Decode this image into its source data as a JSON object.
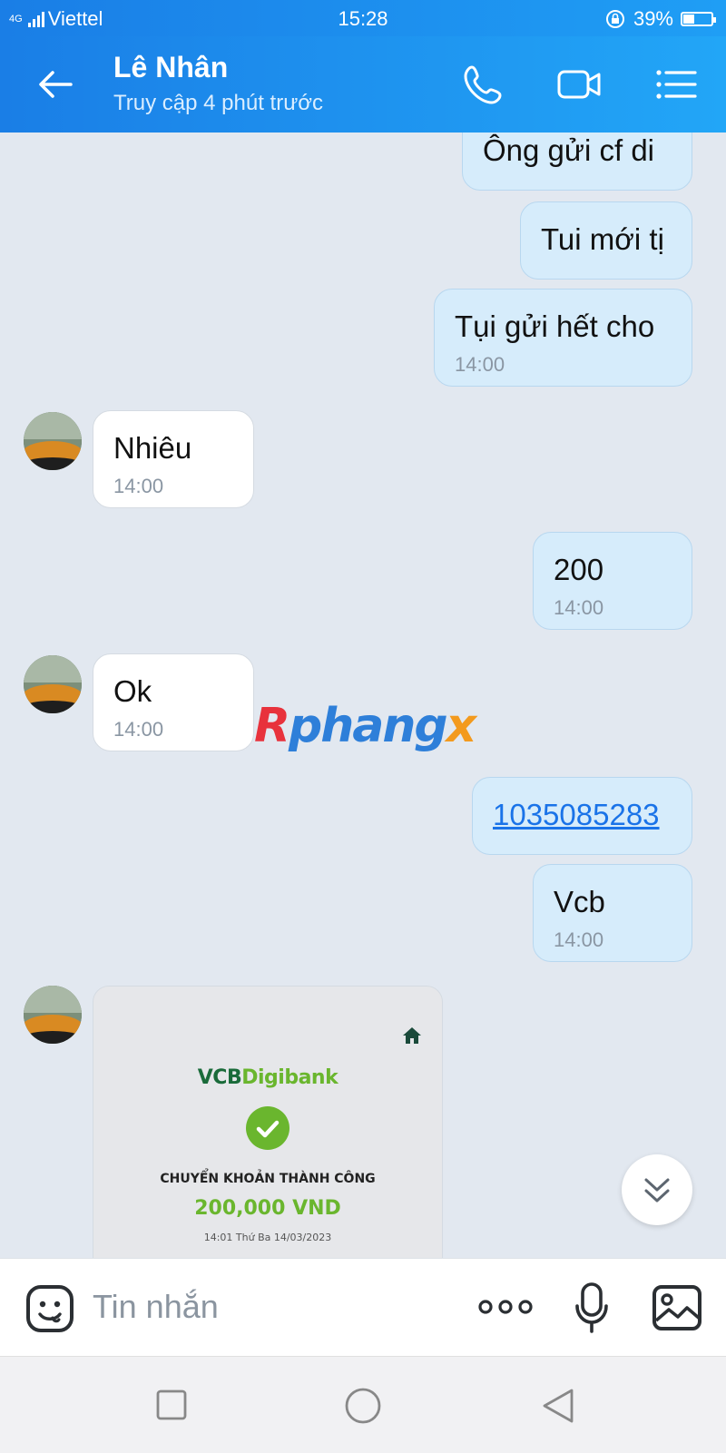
{
  "status": {
    "network": "4G",
    "carrier": "Viettel",
    "time": "15:28",
    "battery_pct": "39%",
    "battery_level": 0.39
  },
  "header": {
    "name": "Lê Nhân",
    "subtitle": "Truy cập 4 phút trước"
  },
  "messages": [
    {
      "text": "Ông gửi cf di",
      "from": "me"
    },
    {
      "text": "Tui mới tị",
      "from": "me"
    },
    {
      "text": "Tụi gửi hết cho",
      "time": "14:00",
      "from": "me"
    },
    {
      "text": "Nhiêu",
      "time": "14:00",
      "from": "them"
    },
    {
      "text": "200",
      "time": "14:00",
      "from": "me"
    },
    {
      "text": "Ok",
      "time": "14:00",
      "from": "them"
    },
    {
      "text": "1035085283",
      "from": "me"
    },
    {
      "text": "Vcb",
      "time": "14:00",
      "from": "me"
    }
  ],
  "receipt": {
    "brand_a": "VCB",
    "brand_b": "Digibank",
    "message": "CHUYỂN KHOẢN THÀNH CÔNG",
    "amount": "200,000 VND",
    "datetime": "14:01 Thứ Ba 14/03/2023"
  },
  "watermark": {
    "a": "R",
    "b": "phang",
    "c": "x"
  },
  "input": {
    "placeholder": "Tin nhắn"
  },
  "colors": {
    "header": "#1a7ee6",
    "my_bubble": "#d6ecfb",
    "background": "#e2e8f0",
    "success": "#6ab62e"
  }
}
